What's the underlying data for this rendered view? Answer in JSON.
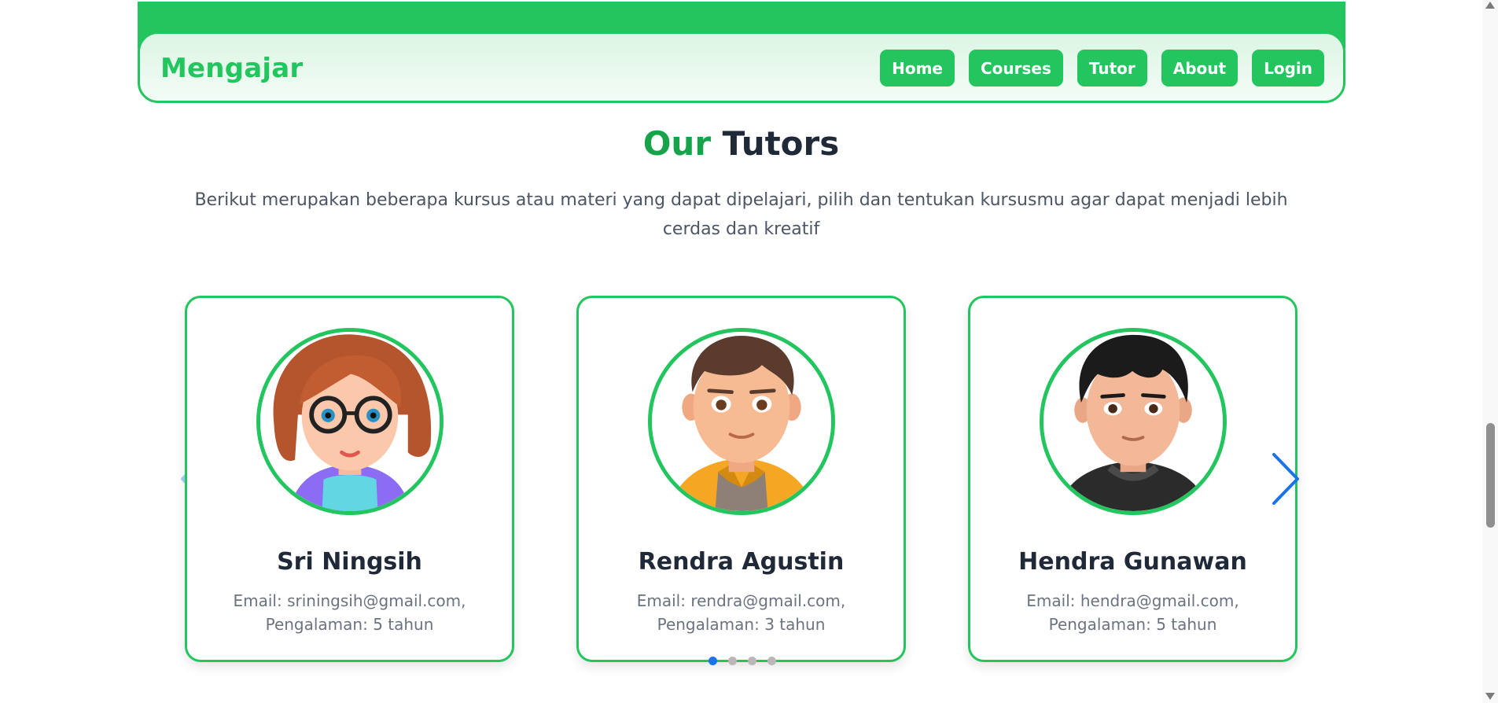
{
  "header": {
    "brand": "Mengajar",
    "nav": [
      {
        "label": "Home"
      },
      {
        "label": "Courses"
      },
      {
        "label": "Tutor"
      },
      {
        "label": "About"
      },
      {
        "label": "Login"
      }
    ]
  },
  "section": {
    "title_accent": "Our",
    "title_rest": "Tutors",
    "description": "Berikut merupakan beberapa kursus atau materi yang dapat dipelajari, pilih dan tentukan kursusmu agar dapat menjadi lebih cerdas dan kreatif"
  },
  "tutors": [
    {
      "name": "Sri Ningsih",
      "email_line": "Email: sriningsih@gmail.com,",
      "experience_line": "Pengalaman: 5 tahun",
      "avatar_icon": "female-glasses-avatar"
    },
    {
      "name": "Rendra Agustin",
      "email_line": "Email: rendra@gmail.com,",
      "experience_line": "Pengalaman: 3 tahun",
      "avatar_icon": "male-hoodie-avatar"
    },
    {
      "name": "Hendra Gunawan",
      "email_line": "Email: hendra@gmail.com,",
      "experience_line": "Pengalaman: 5 tahun",
      "avatar_icon": "male-black-shirt-avatar"
    }
  ],
  "carousel": {
    "slide_count": 4,
    "active_index": 0,
    "prev_icon": "chevron-left-icon",
    "next_icon": "chevron-right-icon"
  },
  "colors": {
    "brand_green": "#22c55e",
    "title_green": "#16a34a",
    "active_dot": "#1a73e8"
  }
}
